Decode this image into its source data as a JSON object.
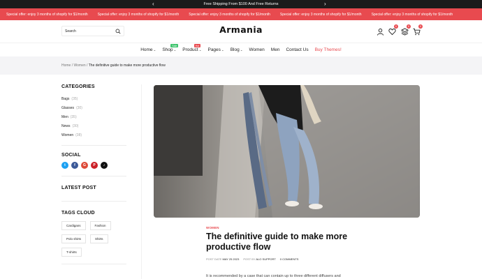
{
  "announcement": {
    "text": "Free Shipping From $100 And Free Returns",
    "prev": "‹",
    "next": "›"
  },
  "promo": {
    "items": [
      "Special offer: enjoy 3 months of shopify for $1/month",
      "Special offer: enjoy 3 months of shopify for $1/month",
      "Special offer: enjoy 3 months of shopify for $1/month",
      "Special offer: enjoy 3 months of shopify for $1/month",
      "Special offer: enjoy 3 months of shopify for $1/month"
    ],
    "color": "#e84a4f"
  },
  "header": {
    "logo": "Armania",
    "search_placeholder": "Search",
    "wishlist_count": "0",
    "compare_count": "0",
    "cart_count": "0",
    "icons": [
      "search-icon",
      "user-icon",
      "heart-icon",
      "compare-icon",
      "cart-icon"
    ]
  },
  "nav": {
    "home": "Home",
    "shop": "Shop",
    "shop_tag": "Sale",
    "shop_tag_color": "#3cc36b",
    "product": "Product",
    "product_tag": "Hot",
    "product_tag_color": "#e84a4f",
    "pages": "Pages",
    "blog": "Blog",
    "women": "Women",
    "men": "Men",
    "contact": "Contact Us",
    "buy": "Buy Themes!"
  },
  "breadcrumb": {
    "home": "Home",
    "sep": "/",
    "women": "Women",
    "current": "The definitive guide to make more productive flow"
  },
  "sidebar": {
    "categories_title": "CATEGORIES",
    "categories": [
      {
        "name": "Bags",
        "count": "(35)"
      },
      {
        "name": "Glasses",
        "count": "(30)"
      },
      {
        "name": "Men",
        "count": "(35)"
      },
      {
        "name": "News",
        "count": "(30)"
      },
      {
        "name": "Women",
        "count": "(38)"
      }
    ],
    "social_title": "SOCIAL",
    "social": [
      {
        "icon": "twitter-icon",
        "glyph": "t",
        "color": "#1da1f2"
      },
      {
        "icon": "facebook-icon",
        "glyph": "f",
        "color": "#3b5998"
      },
      {
        "icon": "google-plus-icon",
        "glyph": "G",
        "color": "#dd4b39"
      },
      {
        "icon": "pinterest-icon",
        "glyph": "P",
        "color": "#cb2027"
      },
      {
        "icon": "tiktok-icon",
        "glyph": "♪",
        "color": "#111111"
      }
    ],
    "latest_title": "LATEST POST",
    "tags_title": "TAGS CLOUD",
    "tags": [
      "Cardigans",
      "Fashion",
      "Polo shirts",
      "Shirts",
      "T-shirts"
    ]
  },
  "article": {
    "category": "WOMEN",
    "title": "The definitive guide to make more productive flow",
    "date_label": "POST DATE",
    "date": "MAY 25 2023",
    "author_label": "POST BY",
    "author": "ALO SUPPORT",
    "comments": "0 COMMENTS",
    "intro": "It is recommended by a case that can contain up to three different diffusers and"
  }
}
